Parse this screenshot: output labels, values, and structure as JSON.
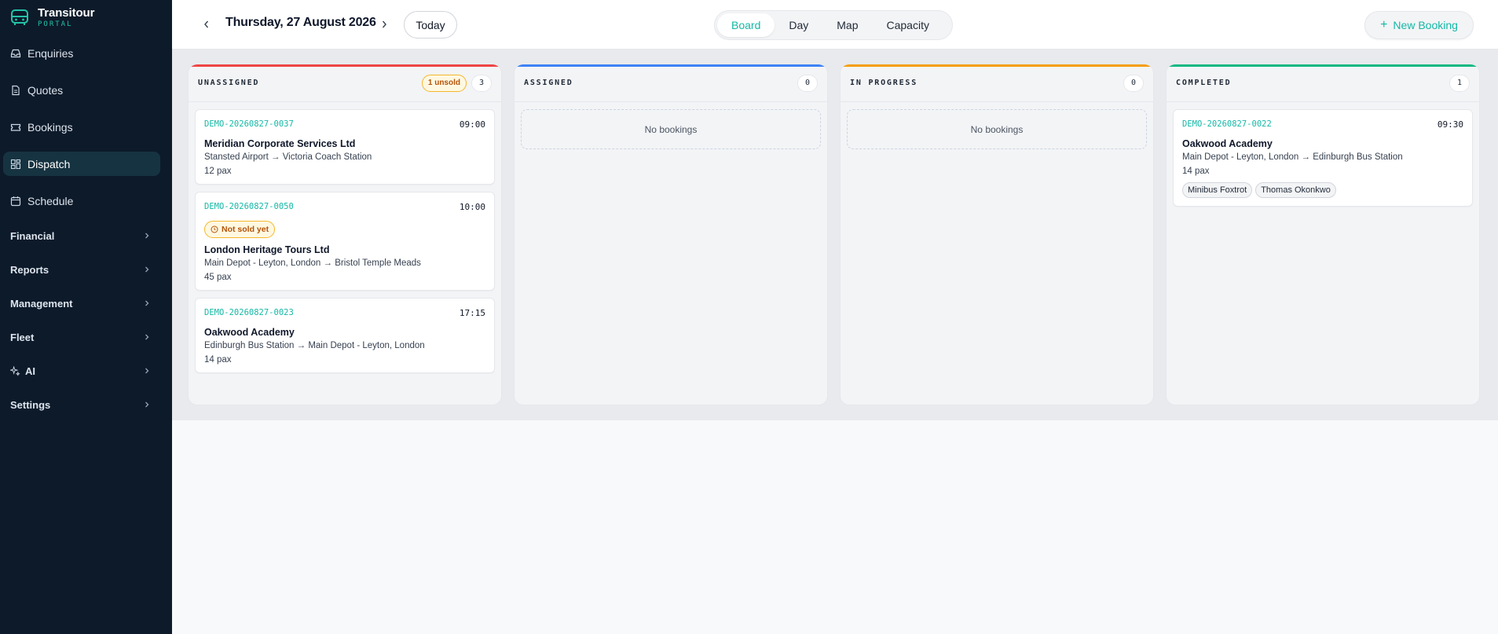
{
  "brand": {
    "name": "Transitour",
    "sub": "PORTAL"
  },
  "sidebar": {
    "items": [
      {
        "label": "Enquiries",
        "icon": "inbox-icon",
        "active": false
      },
      {
        "label": "Quotes",
        "icon": "document-icon",
        "active": false
      },
      {
        "label": "Bookings",
        "icon": "ticket-icon",
        "active": false
      },
      {
        "label": "Dispatch",
        "icon": "grid-icon",
        "active": true
      },
      {
        "label": "Schedule",
        "icon": "calendar-icon",
        "active": false
      }
    ],
    "groups": [
      {
        "label": "Financial"
      },
      {
        "label": "Reports"
      },
      {
        "label": "Management"
      },
      {
        "label": "Fleet"
      },
      {
        "label": "AI",
        "icon": "sparkle-icon"
      },
      {
        "label": "Settings"
      }
    ]
  },
  "topbar": {
    "date": "Thursday, 27 August 2026",
    "today_label": "Today",
    "views": [
      "Board",
      "Day",
      "Map",
      "Capacity"
    ],
    "active_view": "Board",
    "new_booking_label": "New Booking"
  },
  "colors": {
    "accent": "#14b8a6",
    "unassigned": "#ef4444",
    "assigned": "#3b82f6",
    "in_progress": "#f59e0b",
    "completed": "#10b981"
  },
  "columns": [
    {
      "title": "UNASSIGNED",
      "badge": "1 unsold",
      "count": "3",
      "cards": [
        {
          "ref": "DEMO-20260827-0037",
          "time": "09:00",
          "name": "Meridian Corporate Services Ltd",
          "route": "Stansted Airport → Victoria Coach Station",
          "pax": "12 pax"
        },
        {
          "ref": "DEMO-20260827-0050",
          "time": "10:00",
          "badge": "Not sold yet",
          "name": "London Heritage Tours Ltd",
          "route": "Main Depot - Leyton, London → Bristol Temple Meads",
          "pax": "45 pax"
        },
        {
          "ref": "DEMO-20260827-0023",
          "time": "17:15",
          "name": "Oakwood Academy",
          "route": "Edinburgh Bus Station → Main Depot - Leyton, London",
          "pax": "14 pax"
        }
      ]
    },
    {
      "title": "ASSIGNED",
      "count": "0",
      "empty": "No bookings"
    },
    {
      "title": "IN PROGRESS",
      "count": "0",
      "empty": "No bookings"
    },
    {
      "title": "COMPLETED",
      "count": "1",
      "cards": [
        {
          "ref": "DEMO-20260827-0022",
          "time": "09:30",
          "name": "Oakwood Academy",
          "route": "Main Depot - Leyton, London → Edinburgh Bus Station",
          "pax": "14 pax",
          "tags": [
            "Minibus Foxtrot",
            "Thomas Okonkwo"
          ]
        }
      ]
    }
  ]
}
